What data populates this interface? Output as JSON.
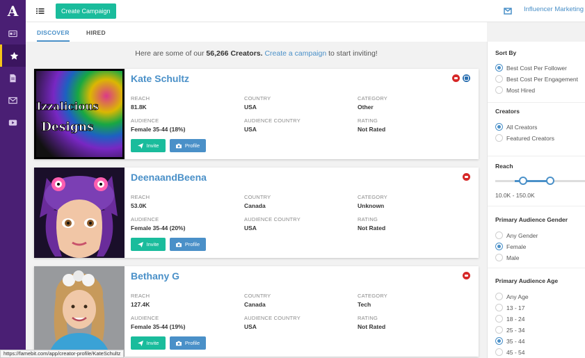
{
  "app": {
    "logo": "A"
  },
  "topbar": {
    "create_label": "Create Campaign",
    "brand_label": "Influencer Marketing for"
  },
  "tabs": [
    {
      "label": "DISCOVER",
      "active": true
    },
    {
      "label": "HIRED",
      "active": false
    }
  ],
  "summary": {
    "prefix": "Here are some of our",
    "count": "56,266 Creators.",
    "link": "Create a campaign",
    "suffix": "to start inviting!"
  },
  "labels": {
    "reach": "REACH",
    "country": "COUNTRY",
    "category": "CATEGORY",
    "audience": "AUDIENCE",
    "audience_country": "AUDIENCE COUNTRY",
    "rating": "RATING",
    "invite": "Invite",
    "profile": "Profile"
  },
  "creators": [
    {
      "name": "Kate Schultz",
      "reach": "81.8K",
      "country": "USA",
      "category": "Other",
      "audience": "Female 35-44 (18%)",
      "audience_country": "USA",
      "rating": "Not Rated",
      "photo_text_1": "Izzalicious",
      "photo_text_2": "Designs"
    },
    {
      "name": "DeenaandBeena",
      "reach": "53.0K",
      "country": "Canada",
      "category": "Unknown",
      "audience": "Female 35-44 (20%)",
      "audience_country": "USA",
      "rating": "Not Rated"
    },
    {
      "name": "Bethany G",
      "reach": "127.4K",
      "country": "Canada",
      "category": "Tech",
      "audience": "Female 35-44 (19%)",
      "audience_country": "USA",
      "rating": "Not Rated"
    }
  ],
  "filters": {
    "sort_by": {
      "title": "Sort By",
      "options": [
        "Best Cost Per Follower",
        "Best Cost Per Engagement",
        "Most Hired"
      ],
      "selected": 0
    },
    "creators": {
      "title": "Creators",
      "options": [
        "All Creators",
        "Featured Creators"
      ],
      "selected": 0
    },
    "reach": {
      "title": "Reach",
      "range": "10.0K - 150.0K"
    },
    "gender": {
      "title": "Primary Audience Gender",
      "options": [
        "Any Gender",
        "Female",
        "Male"
      ],
      "selected": 1
    },
    "age": {
      "title": "Primary Audience Age",
      "options": [
        "Any Age",
        "13 - 17",
        "18 - 24",
        "25 - 34",
        "35 - 44",
        "45 - 54"
      ],
      "selected": 4
    }
  },
  "status_url": "https://famebit.com/app/creator-profile/KateSchultz",
  "colors": {
    "rail": "#4a1f74",
    "accent": "#4a90c8",
    "teal": "#1abc9c"
  }
}
